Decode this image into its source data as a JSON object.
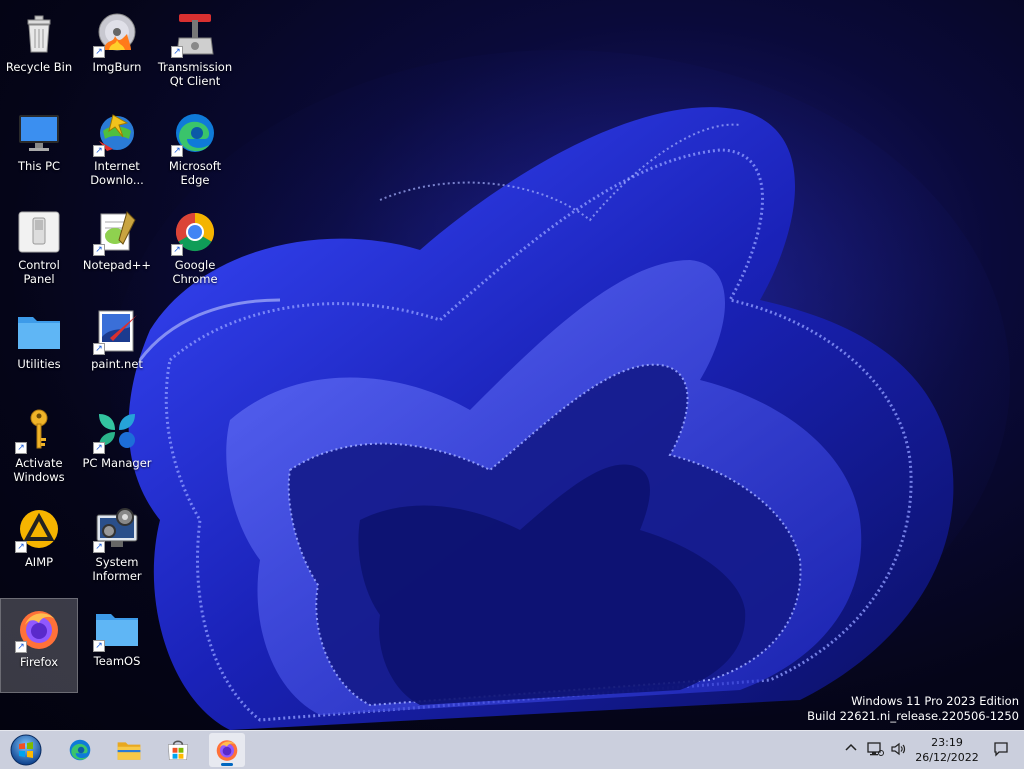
{
  "desktop": {
    "icons": [
      {
        "label": "Recycle Bin"
      },
      {
        "label": "ImgBurn"
      },
      {
        "label": "Transmission Qt Client"
      },
      {
        "label": "This PC"
      },
      {
        "label": "Internet Downlo..."
      },
      {
        "label": "Microsoft Edge"
      },
      {
        "label": "Control Panel"
      },
      {
        "label": "Notepad++"
      },
      {
        "label": "Google Chrome"
      },
      {
        "label": "Utilities"
      },
      {
        "label": "paint.net"
      },
      {
        "label": "Activate Windows"
      },
      {
        "label": "PC Manager"
      },
      {
        "label": "AIMP"
      },
      {
        "label": "System Informer"
      },
      {
        "label": "Firefox"
      },
      {
        "label": "TeamOS"
      }
    ]
  },
  "watermark": {
    "line1": "Windows 11 Pro 2023 Edition",
    "line2": "Build 22621.ni_release.220506-1250"
  },
  "taskbar": {
    "pinned": [
      "start-orb",
      "edge",
      "file-explorer",
      "microsoft-store",
      "firefox"
    ],
    "clock": {
      "time": "23:19",
      "date": "26/12/2022"
    }
  },
  "colors": {
    "accent": "#0067c0",
    "wallpaper": "#0a0a3a",
    "folder": "#4aa8f0"
  }
}
